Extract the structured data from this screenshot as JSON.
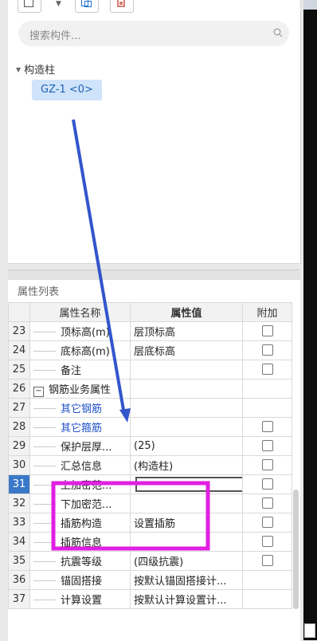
{
  "search": {
    "placeholder": "搜索构件..."
  },
  "tree": {
    "root_label": "构造柱",
    "items": [
      {
        "label": "GZ-1 <0>"
      }
    ]
  },
  "properties": {
    "panel_title": "属性列表",
    "columns": {
      "name": "属性名称",
      "value": "属性值",
      "add": "附加"
    },
    "rows": [
      {
        "num": "23",
        "name": "顶标高(m)",
        "value": "层顶标高",
        "checkbox": true,
        "blue": false
      },
      {
        "num": "24",
        "name": "底标高(m)",
        "value": "层底标高",
        "checkbox": true,
        "blue": false
      },
      {
        "num": "25",
        "name": "备注",
        "value": "",
        "checkbox": true,
        "blue": false
      },
      {
        "num": "26",
        "name": "钢筋业务属性",
        "value": "",
        "checkbox": false,
        "group": true
      },
      {
        "num": "27",
        "name": "其它钢筋",
        "value": "",
        "checkbox": false,
        "blue": true
      },
      {
        "num": "28",
        "name": "其它箍筋",
        "value": "",
        "checkbox": true,
        "blue": true
      },
      {
        "num": "29",
        "name": "保护层厚...",
        "value": "(25)",
        "checkbox": true,
        "blue": false
      },
      {
        "num": "30",
        "name": "汇总信息",
        "value": "(构造柱)",
        "checkbox": true,
        "blue": false
      },
      {
        "num": "31",
        "name": "上加密范...",
        "value": "",
        "checkbox": true,
        "blue": false,
        "selected": true
      },
      {
        "num": "32",
        "name": "下加密范...",
        "value": "",
        "checkbox": true,
        "blue": false
      },
      {
        "num": "33",
        "name": "插筋构造",
        "value": "设置插筋",
        "checkbox": true,
        "blue": false
      },
      {
        "num": "34",
        "name": "插筋信息",
        "value": "",
        "checkbox": true,
        "blue": false
      },
      {
        "num": "35",
        "name": "抗震等级",
        "value": "(四级抗震)",
        "checkbox": true,
        "blue": false
      },
      {
        "num": "36",
        "name": "锚固搭接",
        "value": "按默认锚固搭接计...",
        "checkbox": false,
        "blue": false
      },
      {
        "num": "37",
        "name": "计算设置",
        "value": "按默认计算设置计...",
        "checkbox": false,
        "blue": false
      }
    ]
  },
  "colors": {
    "selected_row": "#3a78c8",
    "blue_text": "#2050c8",
    "annotation_arrow": "#3355cc",
    "annotation_box": "#e020e0"
  },
  "icons": [
    "new-icon",
    "dropdown-arrow-icon",
    "copy-icon",
    "delete-icon",
    "search-icon",
    "expand-collapse-icon"
  ]
}
